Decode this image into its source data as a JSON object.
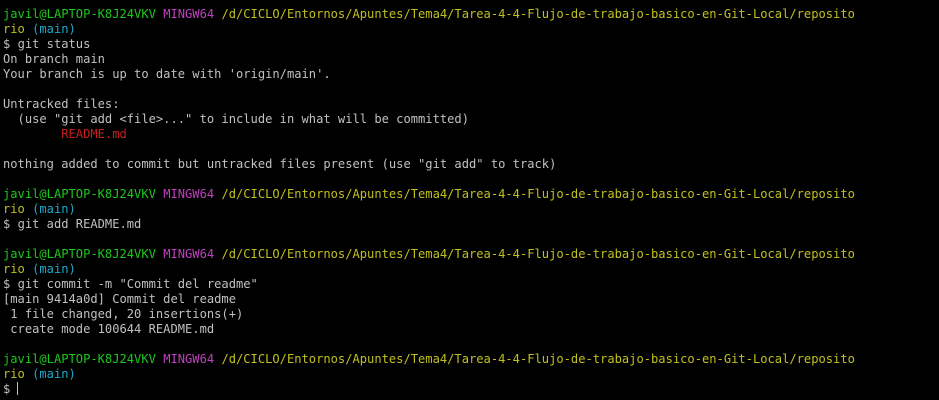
{
  "prompt": {
    "user_host": "javil@LAPTOP-K8J24VKV",
    "env": "MINGW64",
    "path_line": "/d/CICLO/Entornos/Apuntes/Tema4/Tarea-4-4-Flujo-de-trabajo-basico-en-Git-Local/reposito",
    "path_wrap": "rio",
    "branch": "(main)",
    "symbol": "$"
  },
  "commands": {
    "status": "git status",
    "add": "git add README.md",
    "commit": "git commit -m \"Commit del readme\""
  },
  "output": {
    "on_branch": "On branch main",
    "up_to_date": "Your branch is up to date with 'origin/main'.",
    "untracked_header": "Untracked files:",
    "untracked_hint": "  (use \"git add <file>...\" to include in what will be committed)",
    "untracked_file": "        README.md",
    "nothing_added": "nothing added to commit but untracked files present (use \"git add\" to track)",
    "commit_header": "[main 9414a0d] Commit del readme",
    "files_changed": " 1 file changed, 20 insertions(+)",
    "create_mode": " create mode 100644 README.md"
  },
  "colors": {
    "background": "#000000",
    "text": "#c0c0c0",
    "user_host": "#1cc81c",
    "env": "#c040c0",
    "path": "#c0c01e",
    "branch": "#1ea8c8",
    "untracked_file": "#c81e1e"
  }
}
